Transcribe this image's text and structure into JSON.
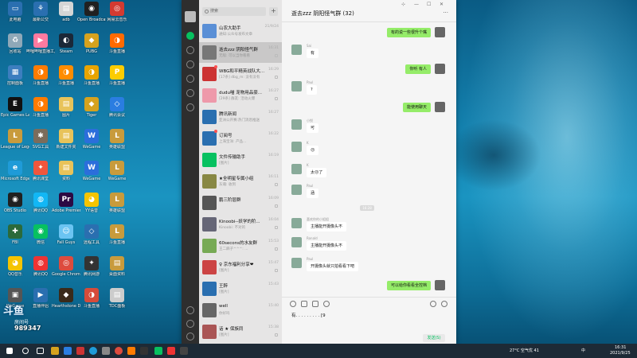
{
  "desktop_icons": [
    {
      "label": "此电脑",
      "color": "#2a6fb0",
      "glyph": "▭"
    },
    {
      "label": "最新公交",
      "color": "#2a6fb0",
      "glyph": "⚘"
    },
    {
      "label": "adb",
      "color": "#d5d5d5",
      "glyph": "▤"
    },
    {
      "label": "Open Broadcast...",
      "color": "#202020",
      "glyph": "◉"
    },
    {
      "label": "网易云音乐",
      "color": "#d33a31",
      "glyph": "◎"
    },
    {
      "label": "回收站",
      "color": "#8fa8b8",
      "glyph": "♻"
    },
    {
      "label": "哔哩哔哩直播工具",
      "color": "#ff7aa0",
      "glyph": "▶"
    },
    {
      "label": "Steam",
      "color": "#1b2838",
      "glyph": "◐"
    },
    {
      "label": "PUBG",
      "color": "#d6a21e",
      "glyph": "◆"
    },
    {
      "label": "斗鱼直播",
      "color": "#ff6a00",
      "glyph": "◑"
    },
    {
      "label": "控制面板",
      "color": "#3c7ebf",
      "glyph": "▦"
    },
    {
      "label": "斗鱼直播",
      "color": "#ff7b00",
      "glyph": "◑"
    },
    {
      "label": "斗鱼直播",
      "color": "#ff8c00",
      "glyph": "◑"
    },
    {
      "label": "斗鱼直播",
      "color": "#e8a400",
      "glyph": "◑"
    },
    {
      "label": "斗鱼直播",
      "color": "#fccc00",
      "glyph": "P"
    },
    {
      "label": "Epic Games Launcher",
      "color": "#111",
      "glyph": "E"
    },
    {
      "label": "斗鱼直播",
      "color": "#ff7b00",
      "glyph": "◑"
    },
    {
      "label": "图片",
      "color": "#e8c35a",
      "glyph": "▤"
    },
    {
      "label": "Tiger",
      "color": "#d6a21e",
      "glyph": "◆"
    },
    {
      "label": "腾讯会议",
      "color": "#2a7de1",
      "glyph": "◇"
    },
    {
      "label": "League of Legends",
      "color": "#c89b3c",
      "glyph": "L"
    },
    {
      "label": "SVG工具",
      "color": "#7b6c5b",
      "glyph": "✱"
    },
    {
      "label": "新建文件夹",
      "color": "#e8c35a",
      "glyph": "▤"
    },
    {
      "label": "WeGame",
      "color": "#2b6edb",
      "glyph": "W"
    },
    {
      "label": "英雄联盟",
      "color": "#c89b3c",
      "glyph": "L"
    },
    {
      "label": "Microsoft Edge",
      "color": "#1f9bd8",
      "glyph": "e"
    },
    {
      "label": "腾讯课堂",
      "color": "#f0563d",
      "glyph": "✦"
    },
    {
      "label": "资料",
      "color": "#e8c35a",
      "glyph": "▤"
    },
    {
      "label": "WeGame",
      "color": "#2b6edb",
      "glyph": "W"
    },
    {
      "label": "WeGame",
      "color": "#c89b3c",
      "glyph": "L"
    },
    {
      "label": "OBS Studio",
      "color": "#202020",
      "glyph": "◉"
    },
    {
      "label": "腾讯QQ",
      "color": "#12b7f5",
      "glyph": "◍"
    },
    {
      "label": "Adobe Premiere",
      "color": "#2c0a43",
      "glyph": "Pr"
    },
    {
      "label": "YY语音",
      "color": "#f5c400",
      "glyph": "◕"
    },
    {
      "label": "英雄联盟",
      "color": "#c89b3c",
      "glyph": "L"
    },
    {
      "label": "FBI",
      "color": "#2b6a3a",
      "glyph": "✚"
    },
    {
      "label": "微信",
      "color": "#07c160",
      "glyph": "◉"
    },
    {
      "label": "Fall Guys",
      "color": "#6bc4f2",
      "glyph": "☺"
    },
    {
      "label": "远程工具",
      "color": "#2a6fb0",
      "glyph": "◇"
    },
    {
      "label": "斗鱼直播",
      "color": "#c89b3c",
      "glyph": "L"
    },
    {
      "label": "QQ音乐",
      "color": "#f5c400",
      "glyph": "◕"
    },
    {
      "label": "腾讯QQ",
      "color": "#e33",
      "glyph": "◍"
    },
    {
      "label": "Google Chrome",
      "color": "#dd4b3e",
      "glyph": "◎"
    },
    {
      "label": "腾讯网游",
      "color": "#333",
      "glyph": "✦"
    },
    {
      "label": "桌面资料",
      "color": "#c89b3c",
      "glyph": "▤"
    },
    {
      "label": "WeGame",
      "color": "#555",
      "glyph": "▣"
    },
    {
      "label": "直播伴侣",
      "color": "#2a6fb0",
      "glyph": "▶"
    },
    {
      "label": "Hearthstone Deck Track...",
      "color": "#3a2a1a",
      "glyph": "◆"
    },
    {
      "label": "斗鱼直播",
      "color": "#d64b3a",
      "glyph": "◑"
    },
    {
      "label": "TDC面板",
      "color": "#ccc",
      "glyph": "▤"
    }
  ],
  "stream_overlay": {
    "logo": "斗鱼",
    "room_label": "房间号",
    "room_id": "989347"
  },
  "wechat": {
    "search": {
      "placeholder": "搜索"
    },
    "add_label": "+",
    "chat_title": "逝去zzz 阴阳怪气群 (32)",
    "more_label": "···",
    "window_controls": [
      "⊹",
      "—",
      "☐",
      "✕"
    ],
    "conversations": [
      {
        "name": "山农大助手",
        "preview": "通知:公众号发布文章",
        "time": "21/9/24",
        "color": "#5a8fd6",
        "muted": false,
        "dot": false
      },
      {
        "name": "逝去zzz 阴阳怪气群",
        "preview": "无敌: 可以当你看看",
        "time": "16:31",
        "color": "#777",
        "muted": true,
        "dot": false,
        "selected": true
      },
      {
        "name": "WBG和平精英战队大...",
        "preview": "[17条] dbg_m: 没有没有",
        "time": "16:29",
        "color": "#c33",
        "muted": true,
        "dot": true
      },
      {
        "name": "dudu喵 宠物用品豪...",
        "preview": "[29条] 群友: 活动火爆",
        "time": "16:27",
        "color": "#e9a",
        "muted": true,
        "dot": false
      },
      {
        "name": "腾讯新闻",
        "preview": "亚洲公开赛:热门消息推送",
        "time": "16:27",
        "color": "#2a6fb0",
        "muted": false,
        "dot": false
      },
      {
        "name": "订阅号",
        "preview": "上海宝洋: 产品...",
        "time": "16:22",
        "color": "#2a6fb0",
        "muted": false,
        "dot": true
      },
      {
        "name": "文件传输助手",
        "preview": "[图片]",
        "time": "16:19",
        "color": "#07c160",
        "muted": false,
        "dot": false
      },
      {
        "name": "★全明星专属小组",
        "preview": "东瀚: 收到",
        "time": "16:11",
        "color": "#884",
        "muted": true,
        "dot": false
      },
      {
        "name": "鹏三阶层群",
        "preview": "",
        "time": "16:09",
        "color": "#555",
        "muted": true,
        "dot": false
      },
      {
        "name": "Kinoobi--妖学的阶...",
        "preview": "Kinoobi: 不对的",
        "time": "16:04",
        "color": "#667",
        "muted": true,
        "dot": false
      },
      {
        "name": "60secons的水友群",
        "preview": "王二麻子^^^: ...",
        "time": "15:53",
        "color": "#7a5",
        "muted": true,
        "dot": false
      },
      {
        "name": "♀ 京东福利分享❤",
        "preview": "[图片]",
        "time": "15:47",
        "color": "#c44",
        "muted": true,
        "dot": false
      },
      {
        "name": "王醉",
        "preview": "[图片]",
        "time": "15:43",
        "color": "#2a6fb0",
        "muted": false,
        "dot": false
      },
      {
        "name": "well",
        "preview": "你好吗",
        "time": "15:40",
        "color": "#666",
        "muted": false,
        "dot": false
      },
      {
        "name": "话 ★ 保族同",
        "preview": "[图片]",
        "time": "15:38",
        "color": "#a55",
        "muted": true,
        "dot": false
      }
    ],
    "messages": [
      {
        "dir": "out",
        "text": "有的说一些很升个嘴",
        "sender": ""
      },
      {
        "dir": "in",
        "text": "有",
        "sender": "Sai"
      },
      {
        "dir": "out",
        "text": "你听 有人",
        "sender": ""
      },
      {
        "dir": "in",
        "text": "?",
        "sender": "Paul"
      },
      {
        "dir": "out",
        "text": "能使用聊天",
        "sender": ""
      },
      {
        "dir": "in",
        "text": "可",
        "sender": "小悦"
      },
      {
        "dir": "in",
        "text": "😐",
        "sender": "K"
      },
      {
        "dir": "in",
        "text": "太😐了",
        "sender": "K"
      },
      {
        "dir": "in",
        "text": "涵",
        "sender": "Paul"
      },
      {
        "dir": "time",
        "text": "16:28",
        "sender": ""
      },
      {
        "dir": "in",
        "text": "主播能开摄像头不",
        "sender": "喜欢你的小姐姐"
      },
      {
        "dir": "in",
        "text": "主播能开摄像头不",
        "sender": "Ronald"
      },
      {
        "dir": "in",
        "text": "开摄像头就只拍看看下吧",
        "sender": "Paul"
      },
      {
        "dir": "out",
        "text": "可以给你看看全控档",
        "sender": ""
      }
    ],
    "input_text": "有.  .  .  .  .  .  .  .  .  [9",
    "send_label": "发送(S)"
  },
  "taskbar": {
    "weather": "27°C 空气优 41",
    "time": "16:31",
    "date": "2021/9/25",
    "lang": "中"
  }
}
